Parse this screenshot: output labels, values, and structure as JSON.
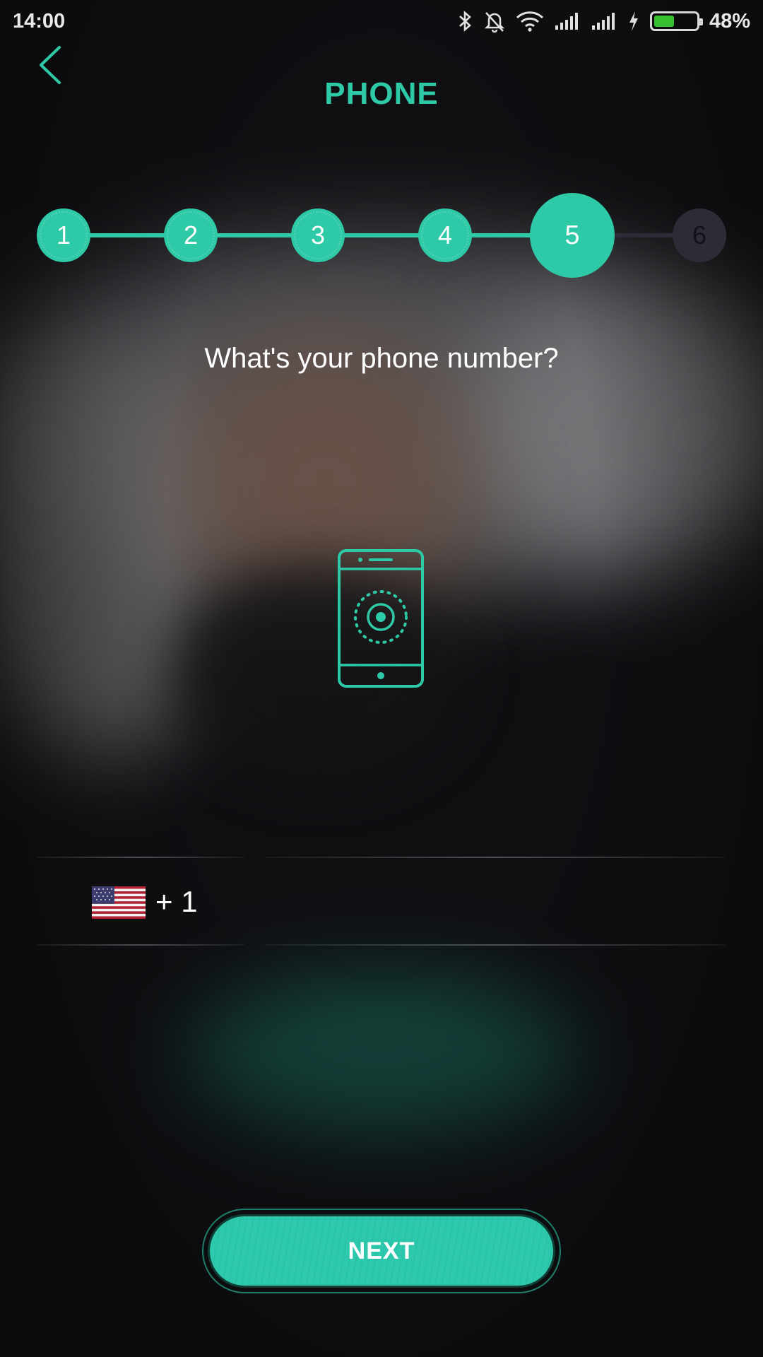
{
  "status_bar": {
    "time": "14:00",
    "battery_percent": "48%",
    "battery_level": 0.48,
    "icons": [
      "bluetooth-icon",
      "bell-off-icon",
      "wifi-icon",
      "signal-icon",
      "signal-icon",
      "charging-icon",
      "battery-icon"
    ]
  },
  "header": {
    "title": "PHONE",
    "back_icon": "chevron-left-icon"
  },
  "stepper": {
    "current_step": 5,
    "steps": [
      {
        "label": "1",
        "state": "done"
      },
      {
        "label": "2",
        "state": "done"
      },
      {
        "label": "3",
        "state": "done"
      },
      {
        "label": "4",
        "state": "done"
      },
      {
        "label": "5",
        "state": "current"
      },
      {
        "label": "6",
        "state": "todo"
      }
    ]
  },
  "main": {
    "question": "What's your phone number?",
    "illustration_icon": "smartphone-icon"
  },
  "phone_input": {
    "country_flag": "us-flag-icon",
    "dial_code": "+ 1",
    "value": "",
    "placeholder": ""
  },
  "actions": {
    "next_label": "NEXT"
  },
  "colors": {
    "accent": "#2ec9a7",
    "background": "#0f0f12",
    "step_inactive": "#2c2c36",
    "battery_fill": "#35c12f"
  }
}
